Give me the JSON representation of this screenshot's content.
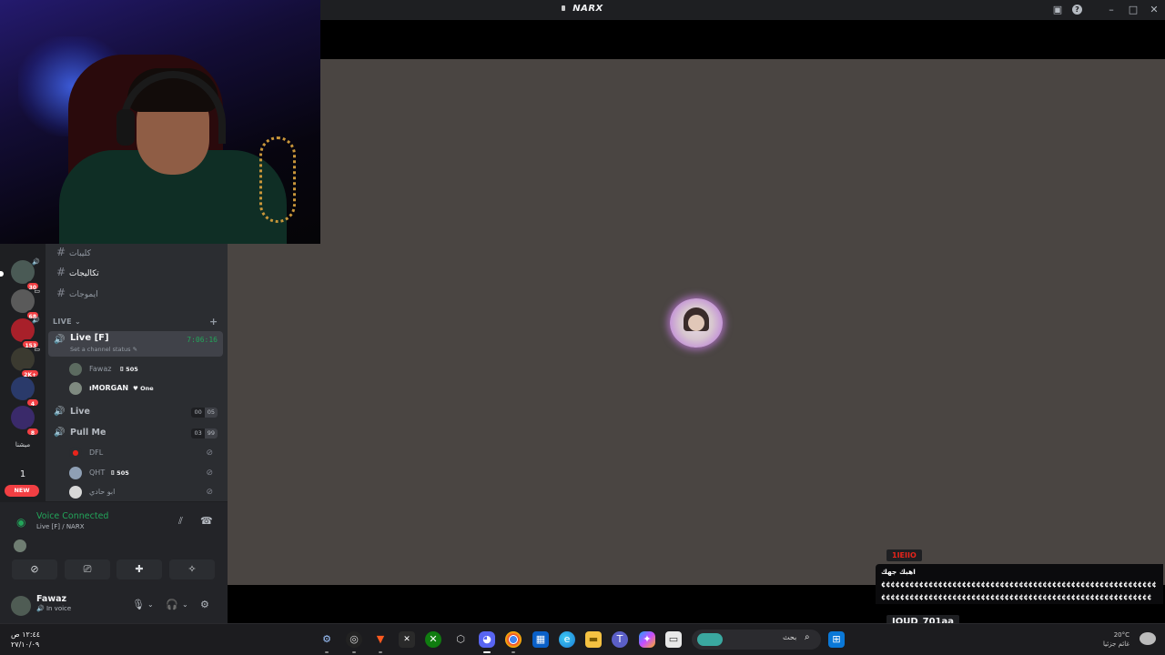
{
  "window": {
    "title": "NARX",
    "controls": [
      "screen-icon",
      "help-icon",
      "minimize-icon",
      "maximize-icon",
      "close-icon"
    ]
  },
  "guilds": [
    {
      "badge": "30",
      "speaker": true
    },
    {
      "badge": "68",
      "speaker": true
    },
    {
      "badge": "153",
      "speaker": true
    },
    {
      "badge": "2K+",
      "speaker": true
    },
    {
      "badge": "4",
      "speaker": false
    },
    {
      "badge": "8",
      "speaker": false
    },
    {
      "label": "ميشنا"
    },
    {
      "label": "1"
    },
    {
      "label": "NEW"
    }
  ],
  "channels": {
    "text": [
      {
        "name": "كليبات"
      },
      {
        "name": "تكاليجات"
      },
      {
        "name": "ايموجات"
      }
    ],
    "category": "LIVE",
    "voice_active": {
      "name": "Live [F]",
      "status": "Set a channel status",
      "timer": "7:06:16",
      "users": [
        {
          "name": "Fawaz",
          "tag": "505"
        },
        {
          "name": "ıMORGAN",
          "tag": "One"
        }
      ]
    },
    "voice_live": {
      "name": "Live",
      "count": "00",
      "limit": "05"
    },
    "voice_pull": {
      "name": "Pull Me",
      "count": "03",
      "limit": "99",
      "users": [
        {
          "name": "DFL",
          "tag": ""
        },
        {
          "name": "QHT",
          "tag": "505"
        },
        {
          "name": "ابو حادي",
          "tag": ""
        }
      ]
    }
  },
  "voice_panel": {
    "title": "Voice Connected",
    "subtitle": "Live [F] / NARX"
  },
  "user_panel": {
    "name": "Fawaz",
    "status": "In voice"
  },
  "chat": [
    {
      "user": "1IEIIO",
      "name_color": "#e8241b",
      "message": "اهبك جهك",
      "message2": "¢¢¢¢¢¢¢¢¢¢¢¢¢¢¢¢¢¢¢¢¢¢¢¢¢¢¢¢¢¢¢¢¢¢¢¢¢¢¢¢¢¢¢¢¢¢¢¢¢¢¢¢¢¢¢¢¢¢¢¢¢¢¢¢¢¢¢¢¢¢¢¢¢¢¢¢¢¢¢¢¢¢¢¢¢¢¢¢¢¢¢¢¢¢¢¢¢¢¢¢¢¢¢¢¢¢¢¢¢¢¢¢¢¢¢¢."
    },
    {
      "user": "JOUD_701aa",
      "name_color": "#f2f3f5",
      "message": "¢¢¢¢¢¢¢¢¢¢¢¢¢¢¢¢¢¢¢¢¢¢¢¢¢¢¢¢¢¢¢¢¢¢¢¢¢¢¢"
    }
  ],
  "taskbar": {
    "clock_time": "١٢:٤٤ ص",
    "clock_date": "٢٧/١٠/٠٩",
    "search_label": "بحث",
    "weather_temp": "20°C",
    "weather_desc": "غائم جزئيا",
    "apps": [
      "steam-icon",
      "obs-icon",
      "brave-icon",
      "capcut-icon",
      "xbox-icon",
      "app-icon",
      "discord-icon",
      "chrome-icon",
      "store-icon",
      "edge-icon",
      "files-icon",
      "teams-icon",
      "copilot-icon",
      "window-icon"
    ]
  }
}
